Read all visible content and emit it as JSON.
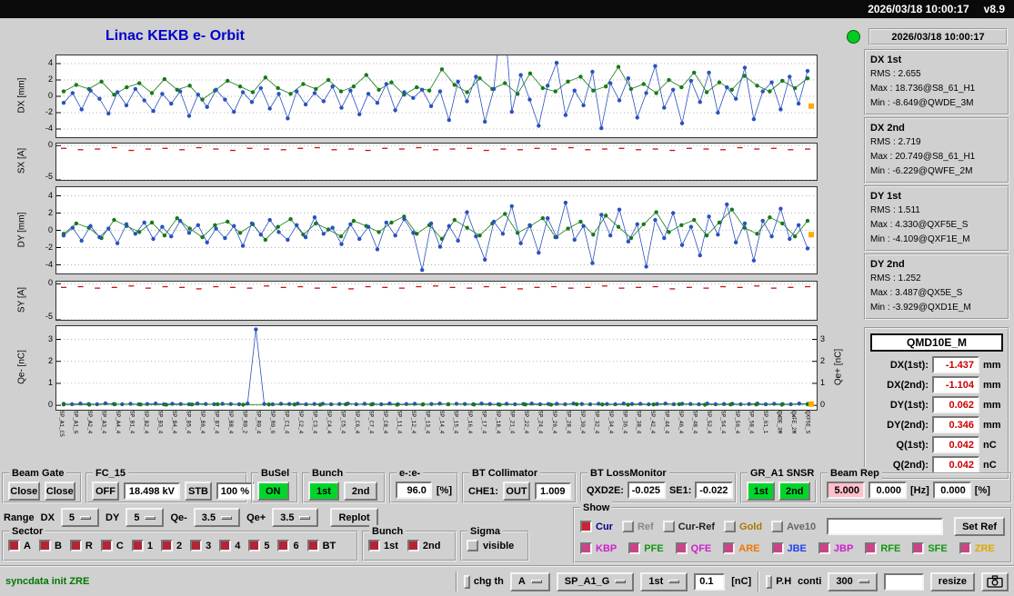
{
  "titlebar": {
    "datetime": "2026/03/18 10:00:17",
    "version": "v8.9"
  },
  "header": {
    "title": "Linac KEKB e- Orbit"
  },
  "colors": {
    "title_blue": "#0000cc",
    "indicator_green": "#00cc22",
    "on_green": "#00d629",
    "warn_pink": "#ffc0cb",
    "value_red": "#cc0000",
    "message_green": "#007700",
    "check_red": "#b32438",
    "check_pink": "#cc4488",
    "series_green": "#177a17",
    "series_blue": "#2a52be",
    "series_redline": "#cc1111",
    "end_marker_orange": "#ffaa00"
  },
  "status_panel": {
    "timestamp": "2026/03/18 10:00:17",
    "stats": [
      {
        "title": "DX 1st",
        "lines": [
          "RMS : 2.655",
          "Max : 18.736@S8_61_H1",
          "Min : -8.649@QWDE_3M"
        ]
      },
      {
        "title": "DX 2nd",
        "lines": [
          "RMS : 2.719",
          "Max : 20.749@S8_61_H1",
          "Min : -6.229@QWFE_2M"
        ]
      },
      {
        "title": "DY 1st",
        "lines": [
          "RMS : 1.511",
          "Max : 4.330@QXF5E_S",
          "Min : -4.109@QXF1E_M"
        ]
      },
      {
        "title": "DY 2nd",
        "lines": [
          "RMS : 1.252",
          "Max : 3.487@QX5E_S",
          "Min : -3.929@QXD1E_M"
        ]
      }
    ],
    "bpm": {
      "title": "QMD10E_M",
      "rows": [
        {
          "label": "DX(1st):",
          "value": "-1.437",
          "unit": "mm"
        },
        {
          "label": "DX(2nd):",
          "value": "-1.104",
          "unit": "mm"
        },
        {
          "label": "DY(1st):",
          "value": "0.062",
          "unit": "mm"
        },
        {
          "label": "DY(2nd):",
          "value": "0.346",
          "unit": "mm"
        },
        {
          "label": "Q(1st):",
          "value": "0.042",
          "unit": "nC"
        },
        {
          "label": "Q(2nd):",
          "value": "0.042",
          "unit": "nC"
        }
      ]
    }
  },
  "controls": {
    "beam_gate": {
      "label": "Beam Gate",
      "buttons": [
        "Close",
        "Close"
      ]
    },
    "fc15": {
      "label": "FC_15",
      "off": "OFF",
      "kv": "18.498 kV",
      "stb": "STB",
      "pct": "100 %"
    },
    "busel": {
      "label": "BuSel",
      "on": "ON"
    },
    "bunch_top": {
      "label": "Bunch",
      "first": "1st",
      "second": "2nd"
    },
    "ee": {
      "label": "e-:e-",
      "value": "96.0",
      "unit": "[%]"
    },
    "bt_collimator": {
      "label": "BT Collimator",
      "che1": "CHE1:",
      "out": "OUT",
      "value": "1.009"
    },
    "bt_lossmonitor": {
      "label": "BT LossMonitor",
      "l1": "QXD2E:",
      "v1": "-0.025",
      "l2": "SE1:",
      "v2": "-0.022"
    },
    "gr_a1": {
      "label": "GR_A1 SNSR",
      "first": "1st",
      "second": "2nd"
    },
    "beam_rep": {
      "label": "Beam Rep",
      "v1": "5.000",
      "v2": "0.000",
      "hz": "[Hz]",
      "v3": "0.000",
      "pct": "[%]"
    },
    "range": {
      "label": "Range",
      "dx_label": "DX",
      "dx": "5",
      "dy_label": "DY",
      "dy": "5",
      "qm_label": "Qe-",
      "qm": "3.5",
      "qp_label": "Qe+",
      "qp": "3.5",
      "replot": "Replot"
    },
    "sector": {
      "label": "Sector",
      "items": [
        "A",
        "B",
        "R",
        "C",
        "1",
        "2",
        "3",
        "4",
        "5",
        "6",
        "BT"
      ]
    },
    "bunch_bottom": {
      "label": "Bunch",
      "items": [
        "1st",
        "2nd"
      ]
    },
    "sigma": {
      "label": "Sigma",
      "item": "visible"
    },
    "show": {
      "label": "Show",
      "row1": [
        {
          "label": "Cur",
          "color": "#000088",
          "checked": true,
          "check_color": "#cc2233"
        },
        {
          "label": "Ref",
          "color": "#888888",
          "checked": false
        },
        {
          "label": "Cur-Ref",
          "color": "#222222",
          "checked": false
        },
        {
          "label": "Gold",
          "color": "#aa7700",
          "checked": false
        },
        {
          "label": "Ave10",
          "color": "#666666",
          "checked": false
        }
      ],
      "ref_value": "",
      "set_ref": "Set Ref",
      "row2": [
        {
          "label": "KBP",
          "color": "#cc22cc",
          "checked": true,
          "check_color": "#cc4488"
        },
        {
          "label": "PFE",
          "color": "#119911",
          "checked": true,
          "check_color": "#cc4488"
        },
        {
          "label": "QFE",
          "color": "#cc22cc",
          "checked": true,
          "check_color": "#cc4488"
        },
        {
          "label": "ARE",
          "color": "#ee7700",
          "checked": true,
          "check_color": "#cc4488"
        },
        {
          "label": "JBE",
          "color": "#2244ee",
          "checked": true,
          "check_color": "#cc4488"
        },
        {
          "label": "JBP",
          "color": "#cc22cc",
          "checked": true,
          "check_color": "#cc4488"
        },
        {
          "label": "RFE",
          "color": "#119911",
          "checked": true,
          "check_color": "#cc4488"
        },
        {
          "label": "SFE",
          "color": "#119911",
          "checked": true,
          "check_color": "#cc4488"
        },
        {
          "label": "ZRE",
          "color": "#ddaa00",
          "checked": true,
          "check_color": "#cc4488"
        }
      ]
    }
  },
  "statusbar": {
    "message": "syncdata init ZRE",
    "chg_th": "chg th",
    "opt_a": "A",
    "opt_sp": "SP_A1_G",
    "opt_bunch": "1st",
    "th_value": "0.1",
    "th_unit": "[nC]",
    "ph": "P.H",
    "conti": "conti",
    "rep": "300",
    "input_value": "",
    "resize": "resize"
  },
  "xaxis_labels": [
    "SP_A1_C5",
    "SP_A1_G",
    "SP_A2_4",
    "SP_A3_4",
    "SP_A4_4",
    "SP_B1_4",
    "SP_B2_4",
    "SP_B3_4",
    "SP_B4_4",
    "SP_B5_4",
    "SP_B6_4",
    "SP_B7_4",
    "SP_B8_4",
    "SP_R0_2",
    "SP_R0_4",
    "SP_R0_6",
    "SP_C1_4",
    "SP_C2_4",
    "SP_C3_4",
    "SP_C4_4",
    "SP_C5_4",
    "SP_C6_4",
    "SP_C7_4",
    "SP_C8_4",
    "SP_11_4",
    "SP_12_4",
    "SP_13_4",
    "SP_14_4",
    "SP_15_4",
    "SP_16_4",
    "SP_17_4",
    "SP_18_4",
    "SP_21_4",
    "SP_22_4",
    "SP_24_4",
    "SP_26_4",
    "SP_28_4",
    "SP_30_4",
    "SP_32_4",
    "SP_34_4",
    "SP_36_4",
    "SP_38_4",
    "SP_42_4",
    "SP_44_4",
    "SP_46_4",
    "SP_48_4",
    "SP_52_4",
    "SP_54_4",
    "SP_56_4",
    "SP_58_4",
    "SP_61_1",
    "QWDE_3M",
    "QWFE_2M",
    "QXF5E_S"
  ],
  "chart_data": [
    {
      "id": "dx",
      "type": "scatter",
      "ylabel": "DX [mm]",
      "ylim": [
        -5,
        5
      ],
      "yticks": [
        4,
        2,
        0,
        -2,
        -4
      ],
      "end_marker": {
        "color": "#ffaa00",
        "y": -1.2
      },
      "series": [
        {
          "name": "bunch-1st",
          "color": "#177a17",
          "marker": "circle",
          "y": [
            0.6,
            1.4,
            0.9,
            1.8,
            0.2,
            1.1,
            1.6,
            0.4,
            2.1,
            0.8,
            1.3,
            -0.4,
            0.7,
            1.9,
            1.2,
            0.5,
            2.3,
            1.0,
            0.3,
            1.5,
            0.9,
            2.0,
            0.6,
            1.2,
            2.6,
            0.8,
            1.7,
            0.2,
            1.1,
            0.7,
            3.3,
            1.4,
            0.5,
            2.2,
            0.9,
            1.6,
            0.3,
            2.8,
            1.0,
            0.6,
            1.8,
            2.4,
            0.7,
            1.2,
            3.6,
            0.9,
            1.5,
            0.4,
            2.0,
            1.1,
            2.9,
            0.5,
            1.7,
            0.8,
            2.5,
            1.3,
            0.6,
            1.9,
            1.0,
            2.2
          ]
        },
        {
          "name": "bunch-2nd",
          "color": "#2a52be",
          "marker": "circle",
          "y": [
            -0.8,
            0.4,
            -1.6,
            0.7,
            -0.3,
            -2.1,
            0.5,
            -1.1,
            0.9,
            -0.5,
            -1.8,
            0.3,
            -0.9,
            0.6,
            -2.4,
            0.2,
            -1.3,
            0.8,
            -0.4,
            -1.9,
            0.5,
            -0.7,
            1.0,
            -1.5,
            0.3,
            -2.7,
            0.6,
            -1.0,
            0.4,
            -0.6,
            1.2,
            -1.4,
            0.7,
            -2.2,
            0.3,
            -0.8,
            1.5,
            -1.7,
            0.5,
            -0.2,
            0.8,
            -1.2,
            0.6,
            -2.9,
            1.8,
            -0.6,
            2.4,
            -3.1,
            0.9,
            12.0,
            -1.9,
            2.6,
            -0.4,
            -3.6,
            1.3,
            4.1,
            -2.3,
            0.7,
            -1.1,
            3.0,
            -3.9,
            1.6,
            -0.5,
            2.2,
            -2.6,
            0.4,
            3.7,
            -1.4,
            0.8,
            -3.3,
            1.9,
            -0.7,
            2.9,
            -2.0,
            1.1,
            -0.3,
            3.5,
            -2.8,
            0.6,
            1.7,
            -1.6,
            2.4,
            -0.9,
            3.1
          ]
        }
      ]
    },
    {
      "id": "sx",
      "type": "scatter",
      "ylabel": "SX [A]",
      "ylim": [
        -5,
        0.3
      ],
      "yticks": [
        0,
        -5
      ],
      "series": [
        {
          "name": "sx",
          "color": "#cc1111",
          "marker": "dash",
          "y": [
            -0.4,
            -0.6,
            -0.5,
            -0.3,
            -0.7,
            -0.5,
            -0.4,
            -0.6,
            -0.3,
            -0.5,
            -0.7,
            -0.4,
            -0.5,
            -0.6,
            -0.4,
            -0.3,
            -0.6,
            -0.5,
            -0.7,
            -0.4,
            -0.5,
            -0.3,
            -0.6,
            -0.5,
            -0.4,
            -0.7,
            -0.5,
            -0.6,
            -0.4,
            -0.5,
            -0.3,
            -0.6,
            -0.5,
            -0.4,
            -0.6,
            -0.5,
            -0.7,
            -0.4,
            -0.5,
            -0.6,
            -0.3,
            -0.5,
            -0.4,
            -0.6,
            -0.5
          ]
        }
      ]
    },
    {
      "id": "dy",
      "type": "scatter",
      "ylabel": "DY [mm]",
      "ylim": [
        -5,
        5
      ],
      "yticks": [
        4,
        2,
        0,
        -2,
        -4
      ],
      "end_marker": {
        "color": "#ffaa00",
        "y": -0.5
      },
      "series": [
        {
          "name": "bunch-1st",
          "color": "#177a17",
          "marker": "circle",
          "y": [
            -0.4,
            0.8,
            0.3,
            -0.9,
            1.2,
            0.5,
            -0.2,
            0.9,
            -0.6,
            1.4,
            0.2,
            -0.8,
            0.6,
            1.0,
            -0.3,
            0.7,
            -1.1,
            0.4,
            1.3,
            -0.5,
            0.8,
            0.1,
            -0.7,
            1.1,
            0.5,
            -0.2,
            0.9,
            1.6,
            -0.4,
            0.6,
            -1.0,
            1.2,
            0.3,
            -0.6,
            0.8,
            1.9,
            -0.3,
            0.5,
            1.4,
            -0.8,
            0.2,
            1.0,
            -0.5,
            1.7,
            0.4,
            -0.9,
            0.7,
            2.1,
            -0.2,
            0.6,
            1.2,
            -0.6,
            0.9,
            2.4,
            0.3,
            -0.4,
            1.5,
            0.8,
            -0.7,
            1.1
          ]
        },
        {
          "name": "bunch-2nd",
          "color": "#2a52be",
          "marker": "circle",
          "y": [
            -0.6,
            0.3,
            -1.2,
            0.5,
            -0.8,
            0.2,
            -1.5,
            0.7,
            -0.4,
            0.9,
            -1.0,
            0.4,
            -0.7,
            1.1,
            -0.3,
            0.6,
            -1.4,
            0.2,
            -0.9,
            0.5,
            -1.8,
            0.8,
            -0.5,
            1.2,
            -0.2,
            -1.1,
            0.6,
            -0.8,
            1.5,
            -0.4,
            0.3,
            -1.6,
            0.7,
            -1.0,
            0.4,
            -2.2,
            0.9,
            -0.6,
            1.3,
            -0.3,
            -4.6,
            0.8,
            -1.9,
            0.5,
            -1.2,
            2.1,
            -0.7,
            -3.4,
            1.0,
            -0.4,
            2.8,
            -1.5,
            0.6,
            -2.6,
            1.4,
            -0.8,
            3.2,
            -1.1,
            0.5,
            -3.8,
            1.8,
            -0.6,
            2.4,
            -1.3,
            0.7,
            -4.2,
            1.2,
            -0.9,
            2.0,
            -1.7,
            0.4,
            -2.9,
            1.6,
            -0.5,
            3.0,
            -1.4,
            0.8,
            -3.5,
            1.1,
            -0.7,
            2.5,
            -1.0,
            0.6,
            -2.1
          ]
        }
      ]
    },
    {
      "id": "sy",
      "type": "scatter",
      "ylabel": "SY [A]",
      "ylim": [
        -5,
        0.3
      ],
      "yticks": [
        0,
        -5
      ],
      "series": [
        {
          "name": "sy",
          "color": "#cc1111",
          "marker": "dash",
          "y": [
            -0.5,
            -0.4,
            -0.6,
            -0.5,
            -0.3,
            -0.6,
            -0.4,
            -0.5,
            -0.7,
            -0.4,
            -0.5,
            -0.6,
            -0.3,
            -0.5,
            -0.4,
            -0.6,
            -0.5,
            -0.7,
            -0.4,
            -0.5,
            -0.6,
            -0.4,
            -0.3,
            -0.5,
            -0.6,
            -0.4,
            -0.5,
            -0.7,
            -0.5,
            -0.4,
            -0.6,
            -0.5,
            -0.3,
            -0.6,
            -0.5,
            -0.4,
            -0.7,
            -0.5,
            -0.6,
            -0.4,
            -0.5,
            -0.3,
            -0.6,
            -0.5,
            -0.4
          ]
        }
      ]
    },
    {
      "id": "q",
      "type": "scatter",
      "ylabel": "Qe- [nC]",
      "ylabel_right": "Qe+ [nC]",
      "ylim": [
        -0.2,
        3.6
      ],
      "yticks": [
        3,
        2,
        1,
        0
      ],
      "yticks_right": [
        3,
        2,
        1,
        0
      ],
      "end_marker": {
        "color": "#ffaa00",
        "y": 0.06
      },
      "series": [
        {
          "name": "q-2nd",
          "color": "#2a52be",
          "marker": "circle",
          "y": [
            0.07,
            0.05,
            0.08,
            0.06,
            0.05,
            0.09,
            0.06,
            0.05,
            0.07,
            0.05,
            0.06,
            0.08,
            0.05,
            0.07,
            0.06,
            0.05,
            0.08,
            0.06,
            0.05,
            0.07,
            0.06,
            0.05,
            0.08,
            3.45,
            0.06,
            0.05,
            0.07,
            0.06,
            0.08,
            0.05,
            0.06,
            0.07,
            0.05,
            0.06,
            0.08,
            0.05,
            0.07,
            0.06,
            0.05,
            0.08,
            0.05,
            0.06,
            0.07,
            0.05,
            0.06,
            0.08,
            0.05,
            0.07,
            0.06,
            0.05,
            0.08,
            0.06,
            0.05,
            0.07,
            0.05,
            0.06,
            0.08,
            0.05,
            0.06,
            0.07,
            0.05,
            0.08,
            0.06,
            0.05,
            0.07,
            0.06,
            0.05,
            0.08,
            0.06,
            0.07,
            0.05,
            0.06,
            0.08,
            0.05,
            0.07,
            0.06,
            0.05,
            0.08,
            0.05,
            0.06,
            0.07,
            0.05,
            0.06,
            0.08,
            0.05,
            0.07,
            0.06,
            0.05,
            0.08,
            0.06
          ]
        },
        {
          "name": "q-1st",
          "color": "#177a17",
          "marker": "circle",
          "y": [
            0.04,
            0.03,
            0.05,
            0.04,
            0.03,
            0.04,
            0.05,
            0.03,
            0.04,
            0.04,
            0.03,
            0.05,
            0.04,
            0.03,
            0.04,
            0.05,
            0.04,
            0.03,
            0.04,
            0.03,
            0.05,
            0.04,
            0.03,
            0.04,
            0.05,
            0.03,
            0.04,
            0.04,
            0.03,
            0.05
          ]
        }
      ]
    }
  ]
}
